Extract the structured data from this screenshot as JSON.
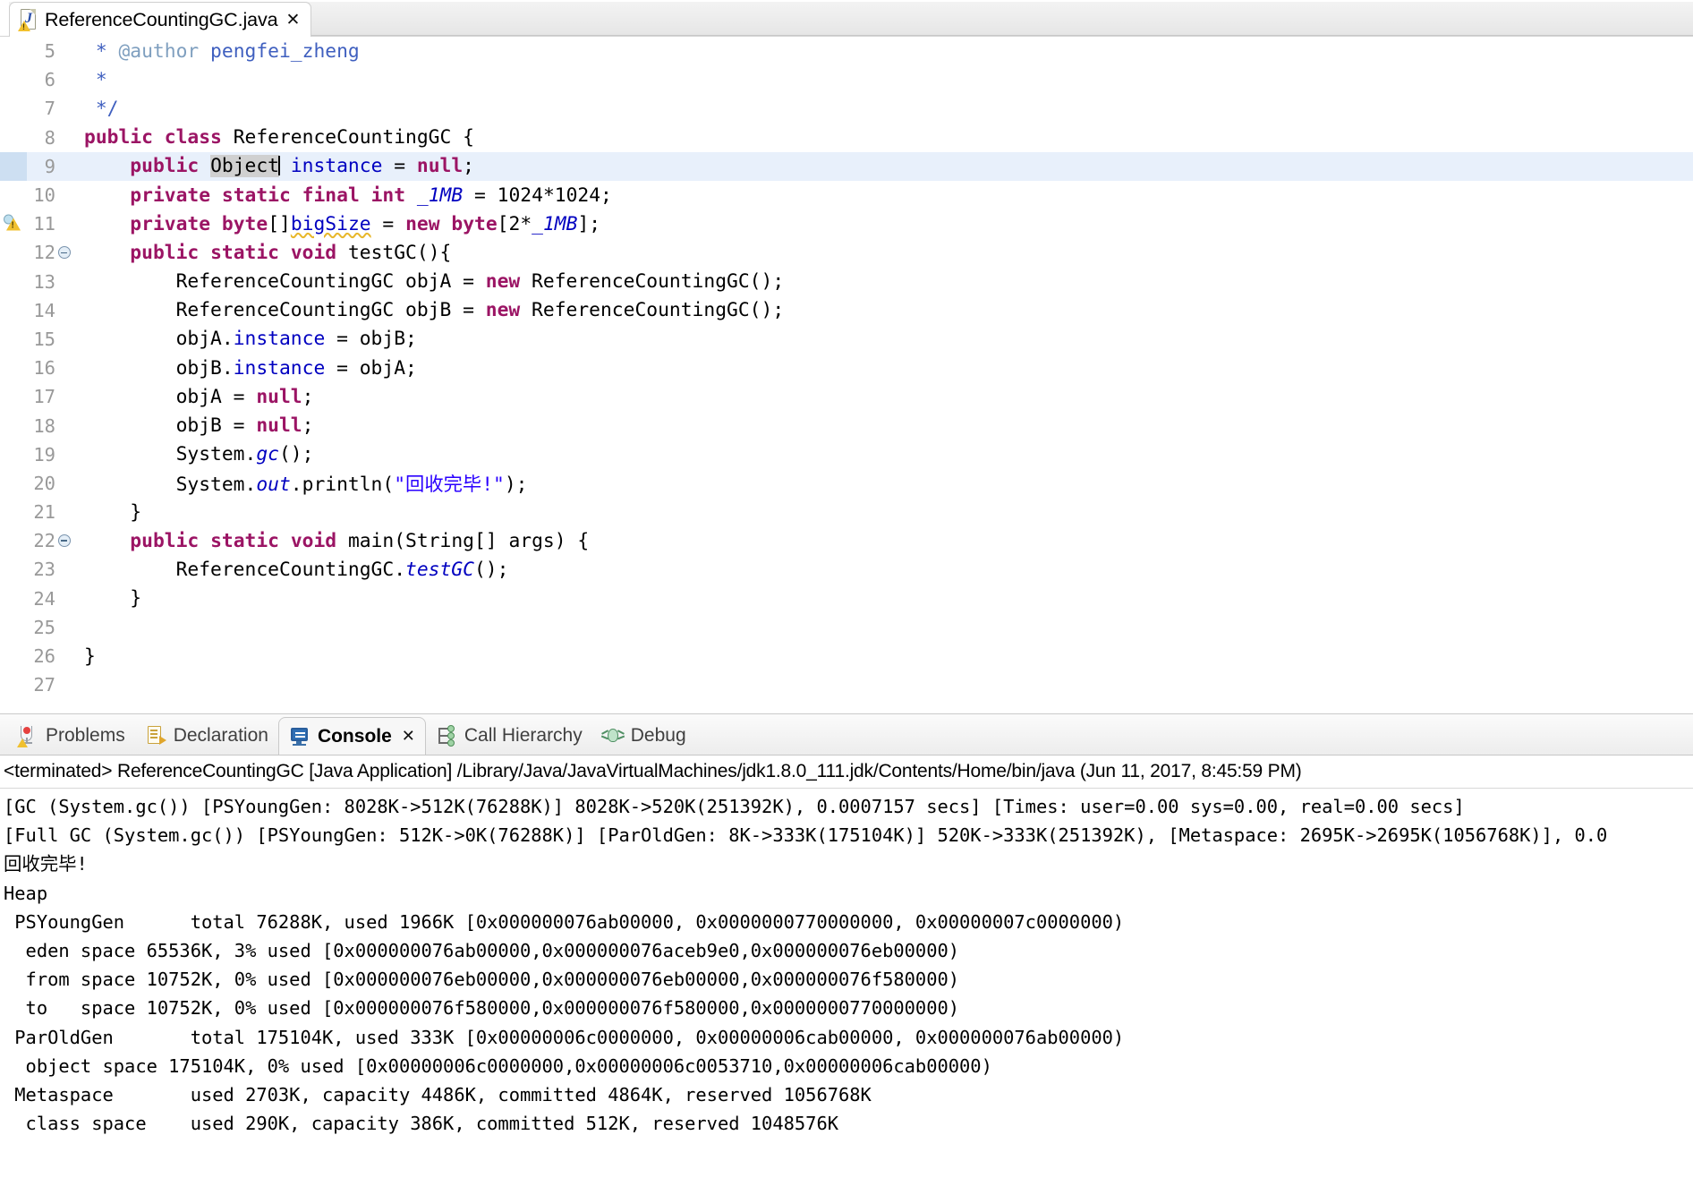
{
  "editor_tab": {
    "title": "ReferenceCountingGC.java",
    "close_glyph": "✕",
    "icon": "java-file-warning-icon"
  },
  "editor": {
    "lines": [
      {
        "num": "5",
        "indent": 1,
        "fold": false,
        "warn": false,
        "highlight": false,
        "text": " * @author pengfei_zheng"
      },
      {
        "num": "6",
        "indent": 1,
        "fold": false,
        "warn": false,
        "highlight": false,
        "text": " *"
      },
      {
        "num": "7",
        "indent": 1,
        "fold": false,
        "warn": false,
        "highlight": false,
        "text": " */"
      },
      {
        "num": "8",
        "indent": 0,
        "fold": false,
        "warn": false,
        "highlight": false,
        "text": "public class ReferenceCountingGC {"
      },
      {
        "num": "9",
        "indent": 1,
        "fold": false,
        "warn": false,
        "highlight": true,
        "text": "    public Object instance = null;"
      },
      {
        "num": "10",
        "indent": 1,
        "fold": false,
        "warn": false,
        "highlight": false,
        "text": "    private static final int _1MB = 1024*1024;"
      },
      {
        "num": "11",
        "indent": 1,
        "fold": false,
        "warn": true,
        "highlight": false,
        "text": "    private byte[]bigSize = new byte[2*_1MB];"
      },
      {
        "num": "12",
        "indent": 1,
        "fold": true,
        "warn": false,
        "highlight": false,
        "text": "    public static void testGC(){"
      },
      {
        "num": "13",
        "indent": 2,
        "fold": false,
        "warn": false,
        "highlight": false,
        "text": "        ReferenceCountingGC objA = new ReferenceCountingGC();"
      },
      {
        "num": "14",
        "indent": 2,
        "fold": false,
        "warn": false,
        "highlight": false,
        "text": "        ReferenceCountingGC objB = new ReferenceCountingGC();"
      },
      {
        "num": "15",
        "indent": 2,
        "fold": false,
        "warn": false,
        "highlight": false,
        "text": "        objA.instance = objB;"
      },
      {
        "num": "16",
        "indent": 2,
        "fold": false,
        "warn": false,
        "highlight": false,
        "text": "        objB.instance = objA;"
      },
      {
        "num": "17",
        "indent": 2,
        "fold": false,
        "warn": false,
        "highlight": false,
        "text": "        objA = null;"
      },
      {
        "num": "18",
        "indent": 2,
        "fold": false,
        "warn": false,
        "highlight": false,
        "text": "        objB = null;"
      },
      {
        "num": "19",
        "indent": 2,
        "fold": false,
        "warn": false,
        "highlight": false,
        "text": "        System.gc();"
      },
      {
        "num": "20",
        "indent": 2,
        "fold": false,
        "warn": false,
        "highlight": false,
        "text": "        System.out.println(\"回收完毕!\");"
      },
      {
        "num": "21",
        "indent": 1,
        "fold": false,
        "warn": false,
        "highlight": false,
        "text": "    }"
      },
      {
        "num": "22",
        "indent": 1,
        "fold": true,
        "warn": false,
        "highlight": false,
        "text": "    public static void main(String[] args) {"
      },
      {
        "num": "23",
        "indent": 2,
        "fold": false,
        "warn": false,
        "highlight": false,
        "text": "        ReferenceCountingGC.testGC();"
      },
      {
        "num": "24",
        "indent": 1,
        "fold": false,
        "warn": false,
        "highlight": false,
        "text": "    }"
      },
      {
        "num": "25",
        "indent": 0,
        "fold": false,
        "warn": false,
        "highlight": false,
        "text": ""
      },
      {
        "num": "26",
        "indent": 0,
        "fold": false,
        "warn": false,
        "highlight": false,
        "text": "}"
      },
      {
        "num": "27",
        "indent": 0,
        "fold": false,
        "warn": false,
        "highlight": false,
        "text": ""
      }
    ],
    "colors": {
      "keyword": "#9b1464",
      "field": "#0000c0",
      "string": "#2a00ff",
      "javadoc": "#3f5fbf",
      "javadoc_tag": "#7f9fbf",
      "line_number": "#999999",
      "current_line_bg": "#e8f0fb",
      "selection_bg": "#d0d0d0",
      "warning_squiggle": "#e8b72b"
    }
  },
  "view_tabs": [
    {
      "label": "Problems",
      "icon": "problems-icon",
      "active": false,
      "closable": false
    },
    {
      "label": "Declaration",
      "icon": "declaration-icon",
      "active": false,
      "closable": false
    },
    {
      "label": "Console",
      "icon": "console-icon",
      "active": true,
      "closable": true
    },
    {
      "label": "Call Hierarchy",
      "icon": "call-hierarchy-icon",
      "active": false,
      "closable": false
    },
    {
      "label": "Debug",
      "icon": "debug-bug-icon",
      "active": false,
      "closable": false
    }
  ],
  "view_tab_close_glyph": "✕",
  "console": {
    "header": "<terminated> ReferenceCountingGC [Java Application] /Library/Java/JavaVirtualMachines/jdk1.8.0_111.jdk/Contents/Home/bin/java (Jun 11, 2017, 8:45:59 PM)",
    "output": [
      "[GC (System.gc()) [PSYoungGen: 8028K->512K(76288K)] 8028K->520K(251392K), 0.0007157 secs] [Times: user=0.00 sys=0.00, real=0.00 secs]",
      "[Full GC (System.gc()) [PSYoungGen: 512K->0K(76288K)] [ParOldGen: 8K->333K(175104K)] 520K->333K(251392K), [Metaspace: 2695K->2695K(1056768K)], 0.0",
      "回收完毕!",
      "Heap",
      " PSYoungGen      total 76288K, used 1966K [0x000000076ab00000, 0x0000000770000000, 0x00000007c0000000)",
      "  eden space 65536K, 3% used [0x000000076ab00000,0x000000076aceb9e0,0x000000076eb00000)",
      "  from space 10752K, 0% used [0x000000076eb00000,0x000000076eb00000,0x000000076f580000)",
      "  to   space 10752K, 0% used [0x000000076f580000,0x000000076f580000,0x0000000770000000)",
      " ParOldGen       total 175104K, used 333K [0x00000006c0000000, 0x00000006cab00000, 0x000000076ab00000)",
      "  object space 175104K, 0% used [0x00000006c0000000,0x00000006c0053710,0x00000006cab00000)",
      " Metaspace       used 2703K, capacity 4486K, committed 4864K, reserved 1056768K",
      "  class space    used 290K, capacity 386K, committed 512K, reserved 1048576K"
    ]
  }
}
